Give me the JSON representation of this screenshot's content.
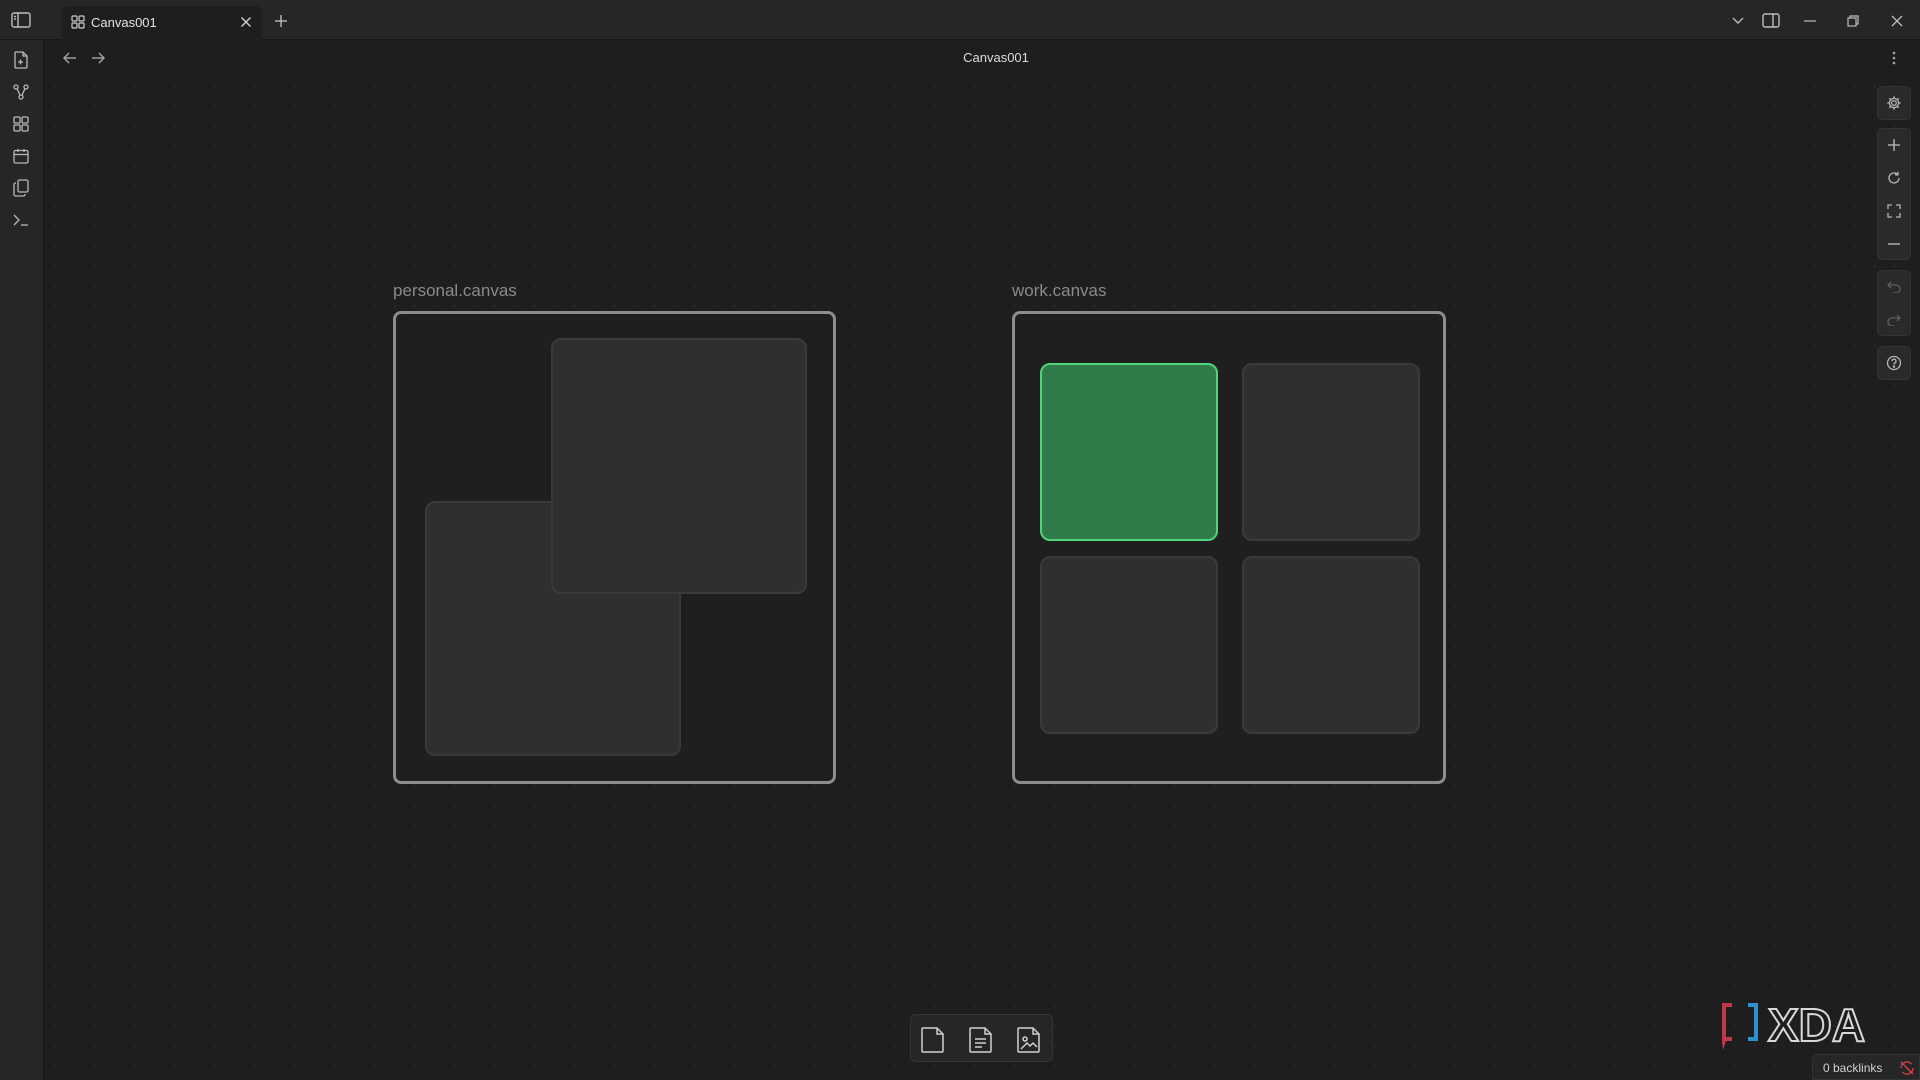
{
  "tab": {
    "title": "Canvas001"
  },
  "view": {
    "title": "Canvas001"
  },
  "canvas": {
    "groups": [
      {
        "label": "personal.canvas"
      },
      {
        "label": "work.canvas"
      }
    ]
  },
  "status_bar": {
    "backlinks": "0 backlinks"
  },
  "watermark": {
    "text": "XDA"
  },
  "colors": {
    "background": "#1e1e1e",
    "card": "#2f2f2f",
    "card_selected_fill": "#317b4a",
    "card_selected_border": "#4fd37b",
    "group_border": "#8d8d8d"
  },
  "icons": {
    "ribbon": [
      "file-plus-icon",
      "graph-icon",
      "canvas-icon",
      "calendar-icon",
      "copy-icon",
      "terminal-icon"
    ],
    "controls": [
      "gear-icon",
      "plus-icon",
      "reset-icon",
      "fit-icon",
      "minus-icon",
      "undo-icon",
      "redo-icon",
      "help-icon"
    ],
    "card_menu": [
      "card-icon",
      "note-icon",
      "media-icon"
    ]
  }
}
